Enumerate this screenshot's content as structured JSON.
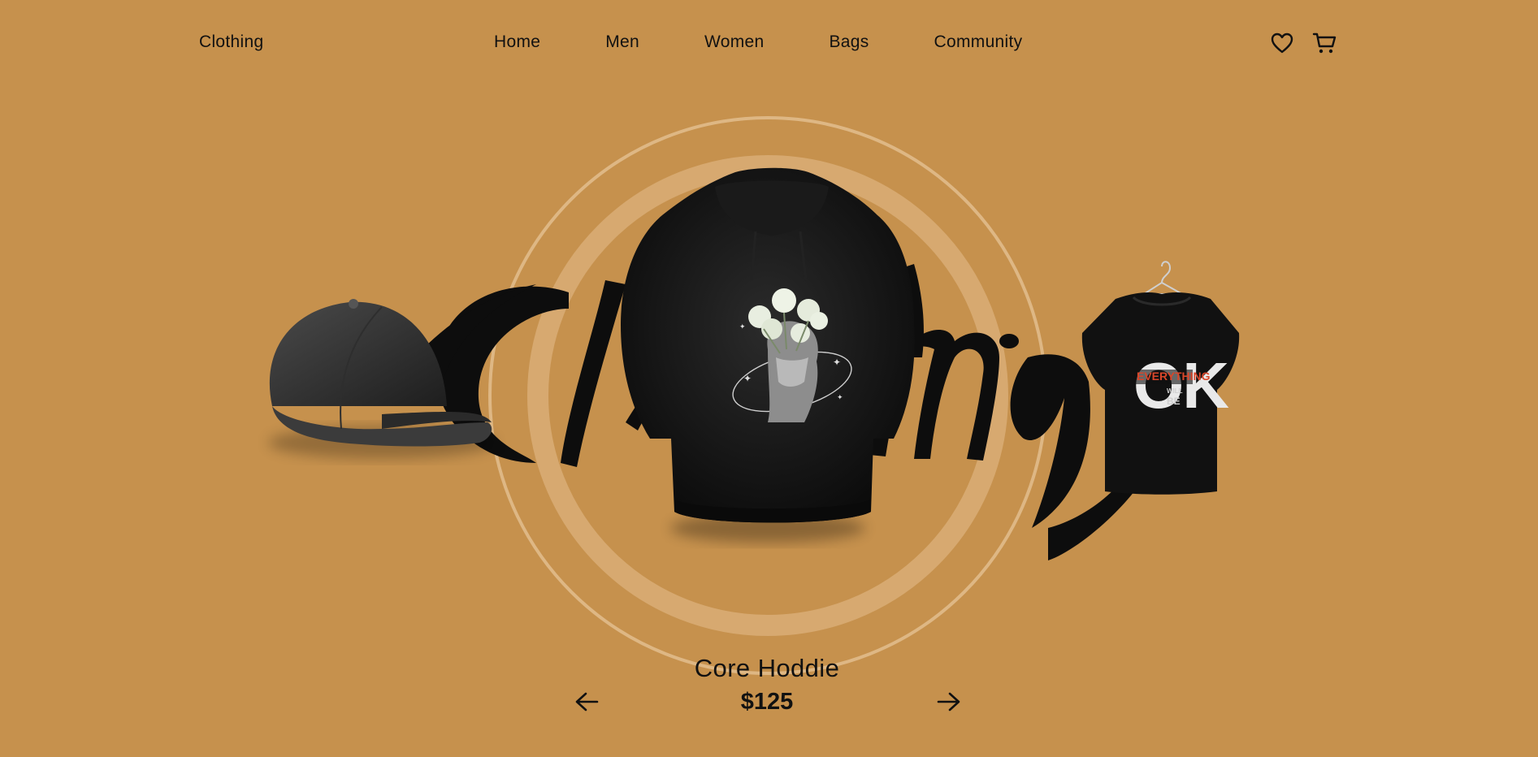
{
  "header": {
    "brand": "Clothing",
    "nav": [
      {
        "label": "Home"
      },
      {
        "label": "Men"
      },
      {
        "label": "Women"
      },
      {
        "label": "Bags"
      },
      {
        "label": "Community"
      }
    ],
    "icons": [
      "heart-icon",
      "cart-icon"
    ]
  },
  "hero": {
    "script_word": "Clothing",
    "tee_print": {
      "big": "OK",
      "band": "EVERYTHING",
      "small_1": "WILL",
      "small_2": "BE"
    }
  },
  "product": {
    "name": "Core Hoddie",
    "price": "$125"
  },
  "carousel": {
    "prev_icon": "arrow-left-icon",
    "next_icon": "arrow-right-icon"
  },
  "colors": {
    "background": "#c6914d",
    "ring": "#e2bd8e",
    "ink": "#111111",
    "accent_red": "#d9462a"
  }
}
